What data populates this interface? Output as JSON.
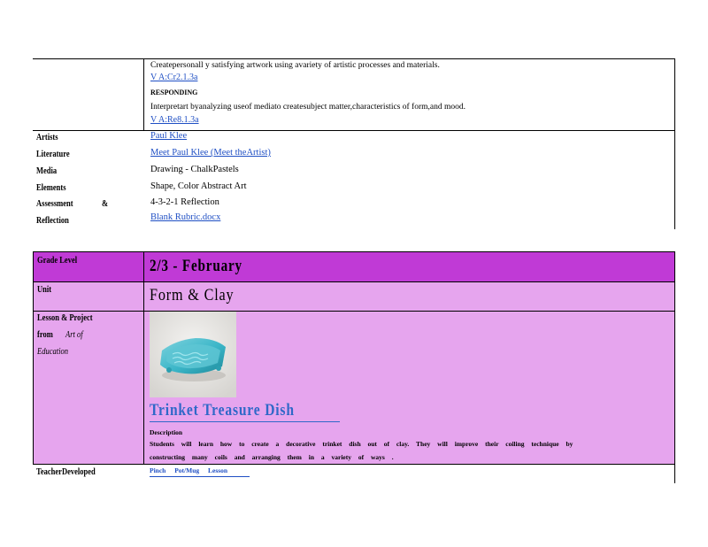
{
  "standards": {
    "create_text": "Createpersonall       y satisfying    artwork    using  avariety    of  artistic  processes     and   materials.",
    "create_code": "V A:Cr2.1.3a",
    "responding_label": "RESPONDING",
    "interpret_text": "Interpretart       byanalyzing     useof   mediato    createsubject       matter,characteristics            of  form,and      mood.",
    "interpret_code": "V A:Re8.1.3a"
  },
  "resources": [
    {
      "label": "Artists",
      "value": "Paul   Klee",
      "is_link": true
    },
    {
      "label": "Literature",
      "value": "Meet    Paul   Klee  (Meet    theArtist)",
      "is_link": true
    },
    {
      "label": "Media",
      "value": "Drawing    - ChalkPastels",
      "is_link": false
    },
    {
      "label": "Elements",
      "value": "Shape,    Color  Abstract   Art",
      "is_link": false
    }
  ],
  "assessment": {
    "label_1": "Assessment",
    "label_amp": "&",
    "label_2": "Reflection",
    "value": "4-3-2-1 Reflection",
    "rubric_link": "Blank  Rubric.docx"
  },
  "lesson_table": {
    "grade_label": "Grade     Level",
    "grade_value": "2/3     - February",
    "unit_label": "Unit",
    "unit_value": "Form     & Clay",
    "lesson_label_1": "Lesson      & Project",
    "lesson_label_2a": "from",
    "lesson_label_2b": "Art    of",
    "lesson_label_3": "Education",
    "project_title": "Trinket          Treasure           Dish",
    "description_heading": "Description",
    "description_line1": "Students          will   learn    how      to   create     a  decorative         trinket     dish   out   of  clay.    They     will   improve      their     coiling      technique           by",
    "description_line2": "constructing          many     coils     and   arranging        them     in  a variety       of  ways      .",
    "teacher_label": "TeacherDeveloped",
    "teacher_link": "Pinch     Pot/Mug          Lesson"
  },
  "colors": {
    "grade_row": "#c03ad6",
    "body_rows": "#e6a5ee",
    "link": "#1f4fc4",
    "project_title": "#2f68c8"
  }
}
